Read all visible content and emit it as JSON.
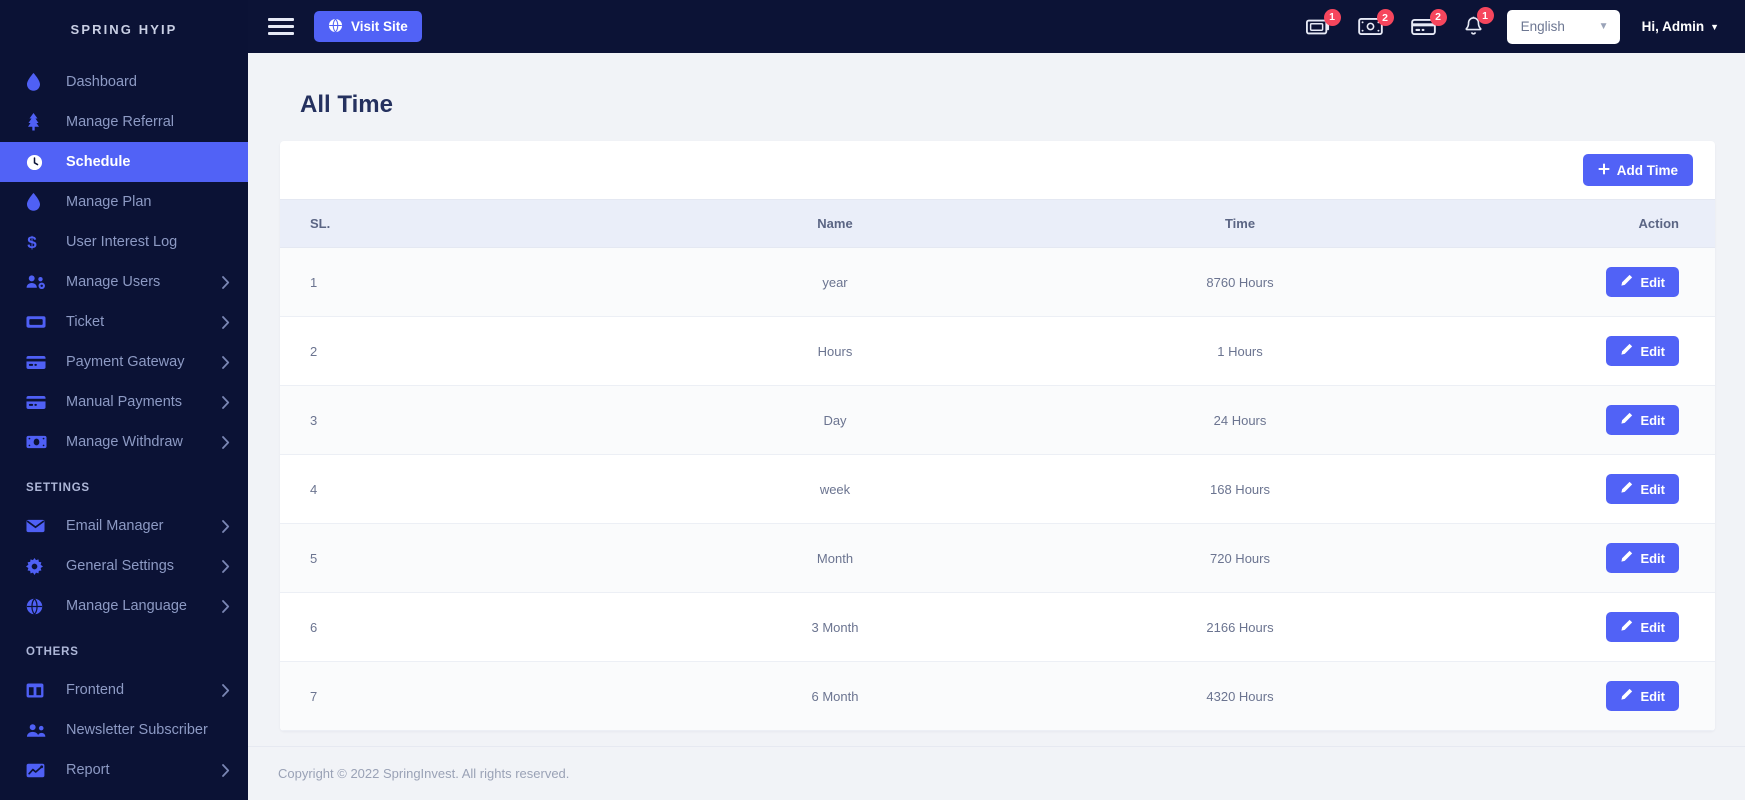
{
  "brand": {
    "name": "SPRING HYIP"
  },
  "sidebar": {
    "items": [
      {
        "label": "Dashboard",
        "icon": "drop-icon",
        "arrow": false,
        "active": false
      },
      {
        "label": "Manage Referral",
        "icon": "tree-icon",
        "arrow": false,
        "active": false
      },
      {
        "label": "Schedule",
        "icon": "clock-icon",
        "arrow": false,
        "active": true
      },
      {
        "label": "Manage Plan",
        "icon": "drop-icon",
        "arrow": false,
        "active": false
      },
      {
        "label": "User Interest Log",
        "icon": "dollar-icon",
        "arrow": false,
        "active": false
      },
      {
        "label": "Manage Users",
        "icon": "users-gear-icon",
        "arrow": true,
        "active": false
      },
      {
        "label": "Ticket",
        "icon": "ticket-icon",
        "arrow": true,
        "active": false
      },
      {
        "label": "Payment Gateway",
        "icon": "credit-card-icon",
        "arrow": true,
        "active": false
      },
      {
        "label": "Manual Payments",
        "icon": "credit-card-icon",
        "arrow": true,
        "active": false
      },
      {
        "label": "Manage Withdraw",
        "icon": "money-bill-icon",
        "arrow": true,
        "active": false
      }
    ],
    "section_settings": "SETTINGS",
    "settings_items": [
      {
        "label": "Email Manager",
        "icon": "envelope-icon",
        "arrow": true
      },
      {
        "label": "General Settings",
        "icon": "gear-icon",
        "arrow": true
      },
      {
        "label": "Manage Language",
        "icon": "globe-icon",
        "arrow": true
      }
    ],
    "section_others": "OTHERS",
    "others_items": [
      {
        "label": "Frontend",
        "icon": "columns-icon",
        "arrow": true
      },
      {
        "label": "Newsletter Subscriber",
        "icon": "users-icon",
        "arrow": false
      },
      {
        "label": "Report",
        "icon": "chart-line-icon",
        "arrow": true
      }
    ]
  },
  "topbar": {
    "menu_icon": "hamburger-icon",
    "visit_site_label": "Visit Site",
    "visit_site_icon": "globe-icon",
    "icons": [
      {
        "name": "deposit-ticket-icon",
        "badge": "1"
      },
      {
        "name": "money-bill-icon",
        "badge": "2"
      },
      {
        "name": "credit-card-icon",
        "badge": "2"
      },
      {
        "name": "bell-icon",
        "badge": "1"
      }
    ],
    "language": "English",
    "language_caret_icon": "chevron-down-icon",
    "admin_label": "Hi, Admin",
    "admin_caret_icon": "caret-down-icon"
  },
  "page": {
    "title": "All Time",
    "add_button_label": "Add Time",
    "add_button_icon": "plus-icon"
  },
  "table": {
    "columns": [
      "SL.",
      "Name",
      "Time",
      "Action"
    ],
    "rows": [
      {
        "sl": "1",
        "name": "year",
        "time": "8760 Hours",
        "action": "Edit"
      },
      {
        "sl": "2",
        "name": "Hours",
        "time": "1 Hours",
        "action": "Edit"
      },
      {
        "sl": "3",
        "name": "Day",
        "time": "24 Hours",
        "action": "Edit"
      },
      {
        "sl": "4",
        "name": "week",
        "time": "168 Hours",
        "action": "Edit"
      },
      {
        "sl": "5",
        "name": "Month",
        "time": "720 Hours",
        "action": "Edit"
      },
      {
        "sl": "6",
        "name": "3 Month",
        "time": "2166 Hours",
        "action": "Edit"
      },
      {
        "sl": "7",
        "name": "6 Month",
        "time": "4320 Hours",
        "action": "Edit"
      }
    ],
    "edit_icon": "pencil-icon"
  },
  "footer": {
    "copyright": "Copyright © 2022 SpringInvest. All rights reserved."
  },
  "colors": {
    "sidebar_bg": "#0b1235",
    "topbar_bg": "#0c1336",
    "accent": "#5162f6",
    "badge": "#f6465d",
    "page_bg": "#f1f3f7",
    "table_head_bg": "#eaeef9",
    "title_text": "#25315f"
  }
}
